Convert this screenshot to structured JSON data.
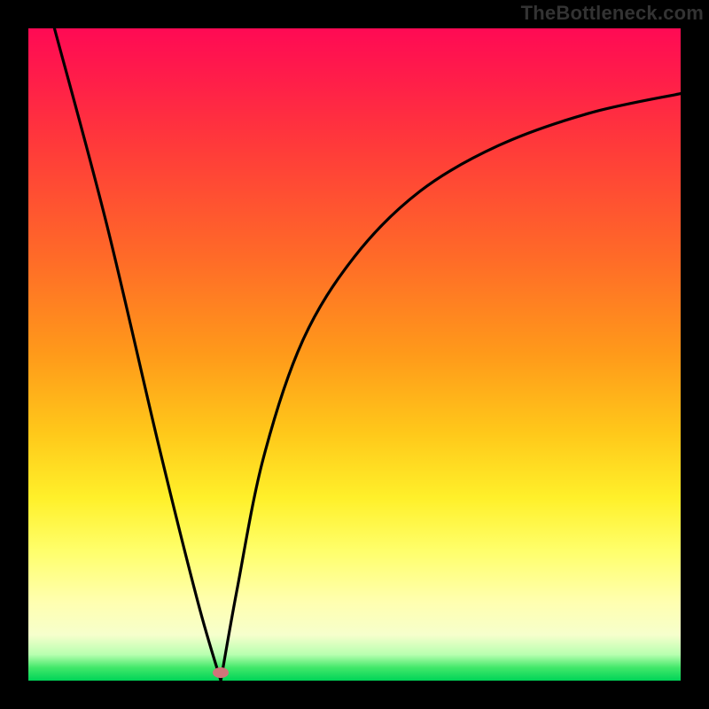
{
  "watermark": "TheBottleneck.com",
  "chart_data": {
    "type": "line",
    "title": "",
    "xlabel": "",
    "ylabel": "",
    "xlim": [
      0,
      100
    ],
    "ylim": [
      0,
      100
    ],
    "grid": false,
    "legend": false,
    "background_gradient": {
      "direction": "vertical",
      "stops": [
        {
          "pos": 0.0,
          "color": "#ff0a54"
        },
        {
          "pos": 0.08,
          "color": "#ff1e49"
        },
        {
          "pos": 0.18,
          "color": "#ff3a3a"
        },
        {
          "pos": 0.35,
          "color": "#ff6a28"
        },
        {
          "pos": 0.5,
          "color": "#ff9a1a"
        },
        {
          "pos": 0.62,
          "color": "#ffc81a"
        },
        {
          "pos": 0.72,
          "color": "#fff02a"
        },
        {
          "pos": 0.8,
          "color": "#ffff6a"
        },
        {
          "pos": 0.88,
          "color": "#ffffb0"
        },
        {
          "pos": 0.93,
          "color": "#f6ffcc"
        },
        {
          "pos": 0.96,
          "color": "#b8ffb0"
        },
        {
          "pos": 0.98,
          "color": "#42e86a"
        },
        {
          "pos": 1.0,
          "color": "#00d458"
        }
      ]
    },
    "series": [
      {
        "name": "left-branch",
        "x": [
          4.0,
          12.0,
          20.0,
          26.0,
          29.5
        ],
        "y": [
          100.0,
          70.0,
          36.0,
          12.0,
          0.0
        ]
      },
      {
        "name": "right-branch",
        "x": [
          29.5,
          32.0,
          36.0,
          42.0,
          50.0,
          60.0,
          72.0,
          86.0,
          100.0
        ],
        "y": [
          0.0,
          14.0,
          34.0,
          52.0,
          65.0,
          75.0,
          82.0,
          87.0,
          90.0
        ]
      }
    ],
    "marker": {
      "name": "trough-dot",
      "x": 29.5,
      "y": 1.2,
      "color": "#d0757a"
    }
  }
}
